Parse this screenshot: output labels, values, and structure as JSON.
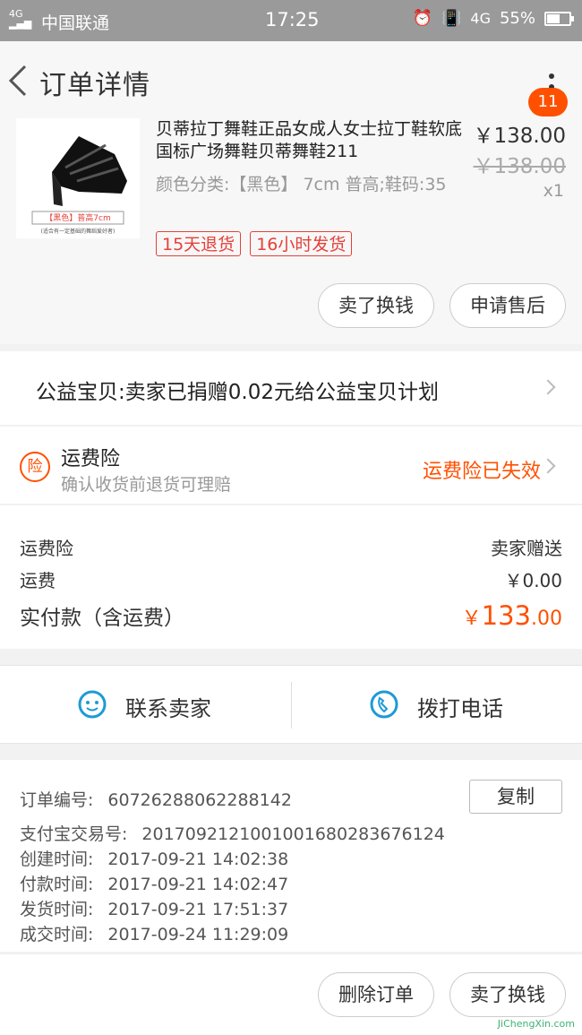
{
  "status": {
    "network": "4G",
    "carrier": "中国联通",
    "time": "17:25",
    "data_type": "4G",
    "battery": "55%"
  },
  "nav": {
    "title": "订单详情",
    "badge": "11"
  },
  "product": {
    "title": "贝蒂拉丁舞鞋正品女成人女士拉丁鞋软底国标广场舞鞋贝蒂舞鞋211",
    "attrs": "颜色分类:【黑色】 7cm 普高;鞋码:35",
    "image_caption": "【黑色】普高7cm",
    "image_note": "(适合有一定基础的舞蹈爱好者)",
    "tags": [
      "15天退货",
      "16小时发货"
    ],
    "price": "￥138.00",
    "original_price": "￥138.00",
    "qty": "x1",
    "buttons": {
      "sell": "卖了换钱",
      "aftersale": "申请售后"
    }
  },
  "charity": {
    "text": "公益宝贝:卖家已捐赠0.02元给公益宝贝计划"
  },
  "insurance": {
    "icon_label": "险",
    "title": "运费险",
    "subtitle": "确认收货前退货可理赔",
    "status": "运费险已失效"
  },
  "fees": {
    "insurance_label": "运费险",
    "insurance_value": "卖家赠送",
    "shipping_label": "运费",
    "shipping_value": "￥0.00",
    "total_label": "实付款（含运费）",
    "total_currency": "￥",
    "total_int": "133",
    "total_dec": ".00"
  },
  "contact": {
    "seller": "联系卖家",
    "phone": "拨打电话"
  },
  "order_info": {
    "copy": "复制",
    "rows": [
      {
        "k": "订单编号:",
        "v": "60726288062288142"
      },
      {
        "k": "支付宝交易号:",
        "v": "2017092121001001680283676124"
      },
      {
        "k": "创建时间:",
        "v": "2017-09-21 14:02:38"
      },
      {
        "k": "付款时间:",
        "v": "2017-09-21 14:02:47"
      },
      {
        "k": "发货时间:",
        "v": "2017-09-21 17:51:37"
      },
      {
        "k": "成交时间:",
        "v": "2017-09-24 11:29:09"
      }
    ]
  },
  "bottom": {
    "delete": "删除订单",
    "sell": "卖了换钱"
  },
  "watermark": "JiChengXin.com",
  "colors": {
    "accent": "#ff5000",
    "tag": "#e5403a",
    "icon_blue": "#1e9ad6"
  }
}
